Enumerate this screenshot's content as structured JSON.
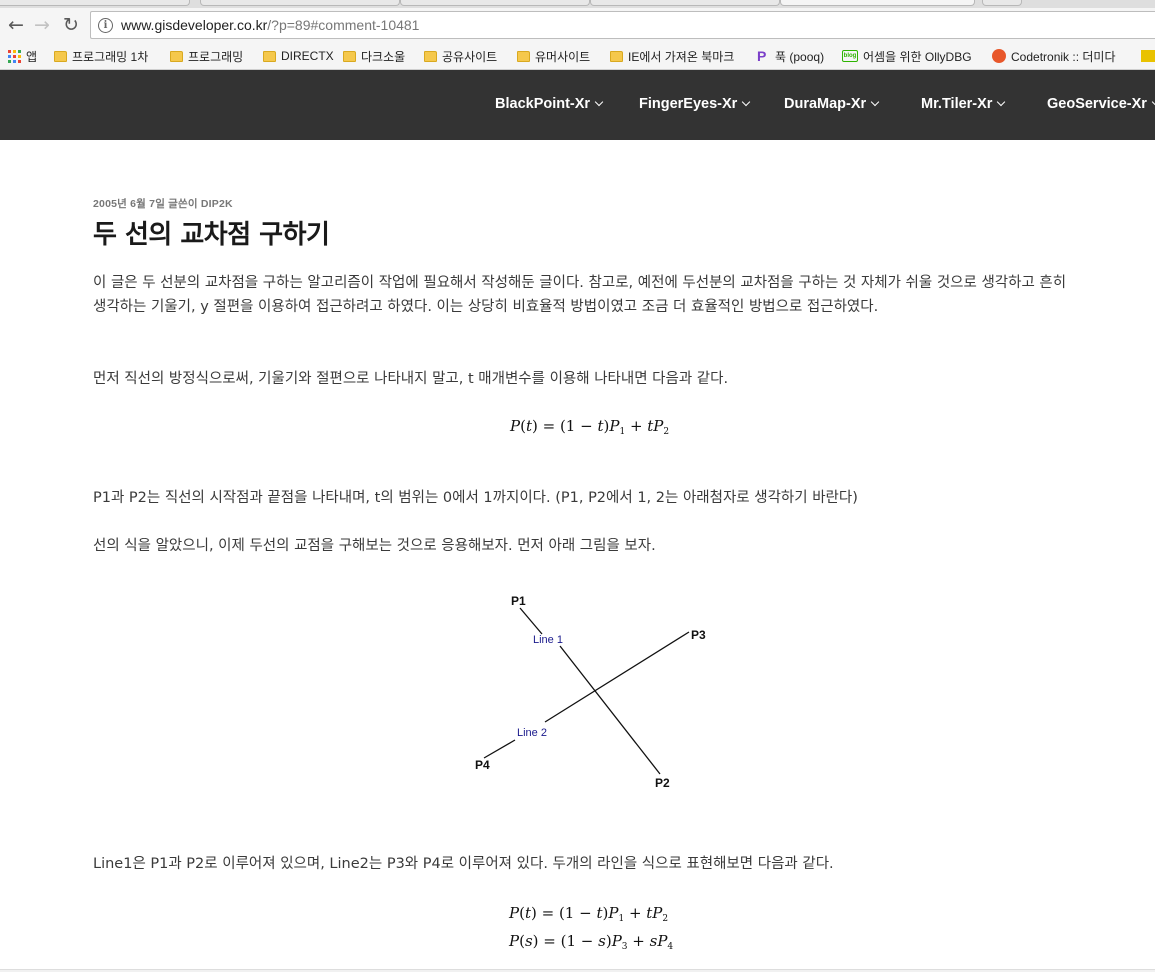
{
  "browser": {
    "url_host": "www.gisdeveloper.co.kr",
    "url_path": "/?p=89#comment-10481",
    "back_glyph": "←",
    "forward_glyph": "→",
    "reload_glyph": "↻",
    "info_glyph": "i"
  },
  "bookmarks": [
    {
      "label": "앱",
      "icon": "apps-icon"
    },
    {
      "label": "프로그래밍 1차",
      "icon": "folder-icon"
    },
    {
      "label": "프로그래밍",
      "icon": "folder-icon"
    },
    {
      "label": "DIRECTX",
      "icon": "folder-icon"
    },
    {
      "label": "다크소울",
      "icon": "folder-icon"
    },
    {
      "label": "공유사이트",
      "icon": "folder-icon"
    },
    {
      "label": "유머사이트",
      "icon": "folder-icon"
    },
    {
      "label": "IE에서 가져온 북마크",
      "icon": "folder-icon"
    },
    {
      "label": "푹 (pooq)",
      "icon": "pooq-icon"
    },
    {
      "label": "어셈을 위한 OllyDBG",
      "icon": "blog-icon"
    },
    {
      "label": "Codetronik :: 더미다",
      "icon": "codetronik-icon"
    }
  ],
  "nav": [
    {
      "label": "BlackPoint-Xr"
    },
    {
      "label": "FingerEyes-Xr"
    },
    {
      "label": "DuraMap-Xr"
    },
    {
      "label": "Mr.Tiler-Xr"
    },
    {
      "label": "GeoService-Xr"
    }
  ],
  "post": {
    "meta": "2005년 6월 7일 글쓴이 DIP2K",
    "title": "두 선의 교차점 구하기",
    "intro": "이 글은 두 선분의 교차점을 구하는 알고리즘이 작업에 필요해서 작성해둔 글이다. 참고로, 예전에 두선분의 교차점을 구하는 것 자체가 쉬울 것으로 생각하고 흔히 생각하는 기울기, y 절편을 이용하여 접근하려고 하였다. 이는 상당히 비효율적 방법이였고 조금 더 효율적인 방법으로 접근하였다.",
    "para2": "먼저 직선의 방정식으로써, 기울기와 절편으로 나타내지 말고, t 매개변수를 이용해 나타내면 다음과 같다.",
    "para3": "P1과 P2는 직선의 시작점과 끝점을 나타내며, t의 범위는 0에서 1까지이다. (P1, P2에서 1, 2는 아래첨자로 생각하기 바란다)",
    "para4": "선의 식을 알았으니, 이제 두선의 교점을 구해보는 것으로 응용해보자. 먼저 아래 그림을 보자.",
    "para5": "Line1은 P1과 P2로 이루어져 있으며, Line2는 P3와 P4로 이루어져 있다. 두개의 라인을 식으로 표현해보면 다음과 같다."
  },
  "diagram": {
    "p1": "P1",
    "p2": "P2",
    "p3": "P3",
    "p4": "P4",
    "line1": "Line 1",
    "line2": "Line 2"
  },
  "colors": {
    "nav_bg": "#333333",
    "line_label": "#1a1a8c"
  }
}
